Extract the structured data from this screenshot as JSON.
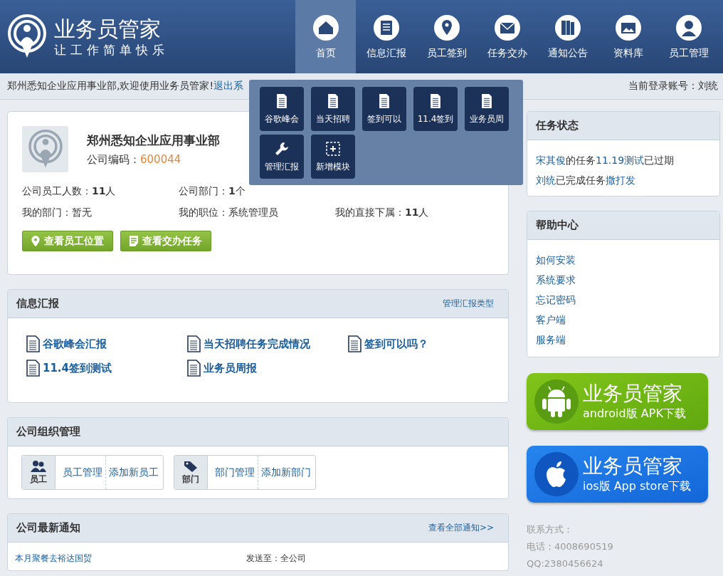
{
  "brand": {
    "title": "业务员管家",
    "slogan": "让工作简单快乐"
  },
  "nav": [
    {
      "label": "首页",
      "kind": "home",
      "selected": true
    },
    {
      "label": "信息汇报",
      "kind": "report",
      "selected": false
    },
    {
      "label": "员工签到",
      "kind": "checkin",
      "selected": false
    },
    {
      "label": "任务交办",
      "kind": "task",
      "selected": false
    },
    {
      "label": "通知公告",
      "kind": "notice",
      "selected": false
    },
    {
      "label": "资料库",
      "kind": "library",
      "selected": false
    },
    {
      "label": "员工管理",
      "kind": "staff",
      "selected": false
    }
  ],
  "subbar": {
    "welcome": "郑州悉知企业应用事业部,欢迎使用业务员管家!",
    "logout": "退出系",
    "account": "当前登录账号：刘统"
  },
  "report_menu": [
    {
      "label": "谷歌峰会",
      "kind": "doc"
    },
    {
      "label": "当天招聘",
      "kind": "doc"
    },
    {
      "label": "签到可以",
      "kind": "doc"
    },
    {
      "label": "11.4签到",
      "kind": "doc"
    },
    {
      "label": "业务员周",
      "kind": "doc"
    },
    {
      "label": "管理汇报",
      "kind": "tool"
    },
    {
      "label": "新增模块",
      "kind": "add"
    }
  ],
  "company": {
    "name": "郑州悉知企业应用事业部",
    "code_label": "公司编码：",
    "code": "600044",
    "facts": [
      [
        "公司员工人数：**11**人",
        "公司部门：**1**个"
      ],
      [
        "我的部门：暂无",
        "我的职位：系统管理员",
        "我的直接下属：**11**人"
      ]
    ],
    "buttons": [
      {
        "label": "查看员工位置",
        "kind": "pin"
      },
      {
        "label": "查看交办任务",
        "kind": "doc"
      }
    ]
  },
  "reports": {
    "title": "信息汇报",
    "action": "管理汇报类型",
    "items": [
      "谷歌峰会汇报",
      "当天招聘任务完成情况",
      "签到可以吗？",
      "11.4签到测试",
      "业务员周报"
    ]
  },
  "org": {
    "title": "公司组织管理",
    "groups": [
      {
        "kind": "people",
        "label": "员工",
        "links": [
          "员工管理",
          "添加新员工"
        ]
      },
      {
        "kind": "tag",
        "label": "部门",
        "links": [
          "部门管理",
          "添加新部门"
        ]
      }
    ]
  },
  "notices": {
    "title": "公司最新通知",
    "action": "查看全部通知>>",
    "rows": [
      {
        "title": "本月聚餐去裕达国贸",
        "target": "发送至：全公司"
      }
    ]
  },
  "task_status": {
    "title": "任务状态",
    "lines": [
      [
        {
          "text": "宋其俊",
          "link": true
        },
        {
          "text": "的任务",
          "link": false
        },
        {
          "text": "11.19测试",
          "link": true
        },
        {
          "text": "已过期",
          "link": false
        }
      ],
      [
        {
          "text": "刘统",
          "link": true
        },
        {
          "text": "已完成任务",
          "link": false
        },
        {
          "text": "撒打发",
          "link": true
        }
      ]
    ]
  },
  "help": {
    "title": "帮助中心",
    "links": [
      "如何安装",
      "系统要求",
      "忘记密码",
      "客户端",
      "服务端"
    ]
  },
  "downloads": [
    {
      "kind": "android",
      "title": "业务员管家",
      "subtitle": "android版 APK下载"
    },
    {
      "kind": "ios",
      "title": "业务员管家",
      "subtitle": "ios版 App store下载"
    }
  ],
  "contact": [
    "联系方式：",
    "电话：4008690519",
    "QQ:2380456624"
  ]
}
